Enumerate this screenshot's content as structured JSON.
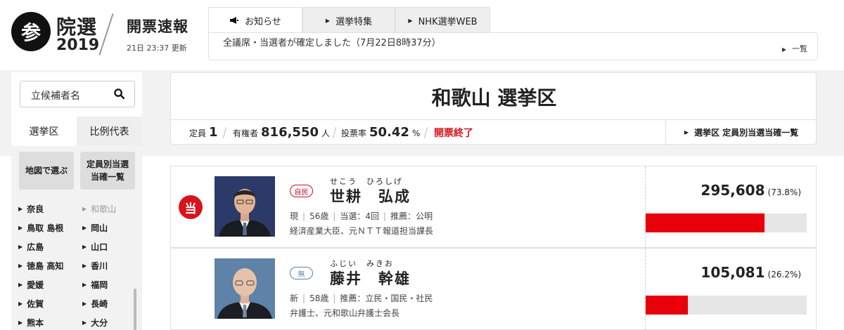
{
  "logo": {
    "badge": "参",
    "title": "院選",
    "year": "2019"
  },
  "site": {
    "title": "開票速報",
    "updated": "21日 23:37 更新"
  },
  "tabs": [
    {
      "label": "お知らせ",
      "icon": "megaphone-icon"
    },
    {
      "label": "選挙特集",
      "icon": "arrow-right-icon"
    },
    {
      "label": "NHK選挙WEB",
      "icon": "arrow-right-icon"
    }
  ],
  "notice": {
    "text": "全議席・当選者が確定しました（7月22日8時37分）",
    "more": "一覧"
  },
  "sidebar": {
    "search_placeholder": "立候補者名",
    "tabs": [
      "選挙区",
      "比例代表"
    ],
    "buttons": [
      "地図で選ぶ",
      "定員別当選\n当確一覧"
    ],
    "prefectures": [
      [
        "奈良",
        "和歌山"
      ],
      [
        "鳥取 島根",
        "岡山"
      ],
      [
        "広島",
        "山口"
      ],
      [
        "徳島 高知",
        "香川"
      ],
      [
        "愛媛",
        "福岡"
      ],
      [
        "佐賀",
        "長崎"
      ],
      [
        "熊本",
        "大分"
      ]
    ],
    "current_prefecture": "和歌山"
  },
  "district": {
    "title": "和歌山 選挙区",
    "seats_label": "定員",
    "seats": "1",
    "voters_label": "有権者",
    "voters": "816,550",
    "voters_unit": "人",
    "turnout_label": "投票率",
    "turnout": "50.42",
    "turnout_unit": "%",
    "status": "開票終了",
    "list_link": "選挙区 定員別当選当確一覧"
  },
  "candidates": [
    {
      "elected": true,
      "elected_mark": "当",
      "party": "自民",
      "party_color": "#c8102e",
      "kana": "せこう　ひろしげ",
      "name": "世耕　弘成",
      "status": "現",
      "age": "56歳",
      "terms": "当選：4回",
      "endorsement": "推薦：公明",
      "career": "経済産業大臣、元ＮＴＴ報道担当課長",
      "votes": "295,608",
      "percent": "(73.8%)",
      "share": 0.738
    },
    {
      "elected": false,
      "elected_mark": "",
      "party": "無",
      "party_color": "#5a7fa8",
      "kana": "ふじい　みきお",
      "name": "藤井　幹雄",
      "status": "新",
      "age": "58歳",
      "terms": "",
      "endorsement": "推薦：立民・国民・社民",
      "career": "弁護士、元和歌山弁護士会長",
      "votes": "105,081",
      "percent": "(26.2%)",
      "share": 0.262
    }
  ]
}
